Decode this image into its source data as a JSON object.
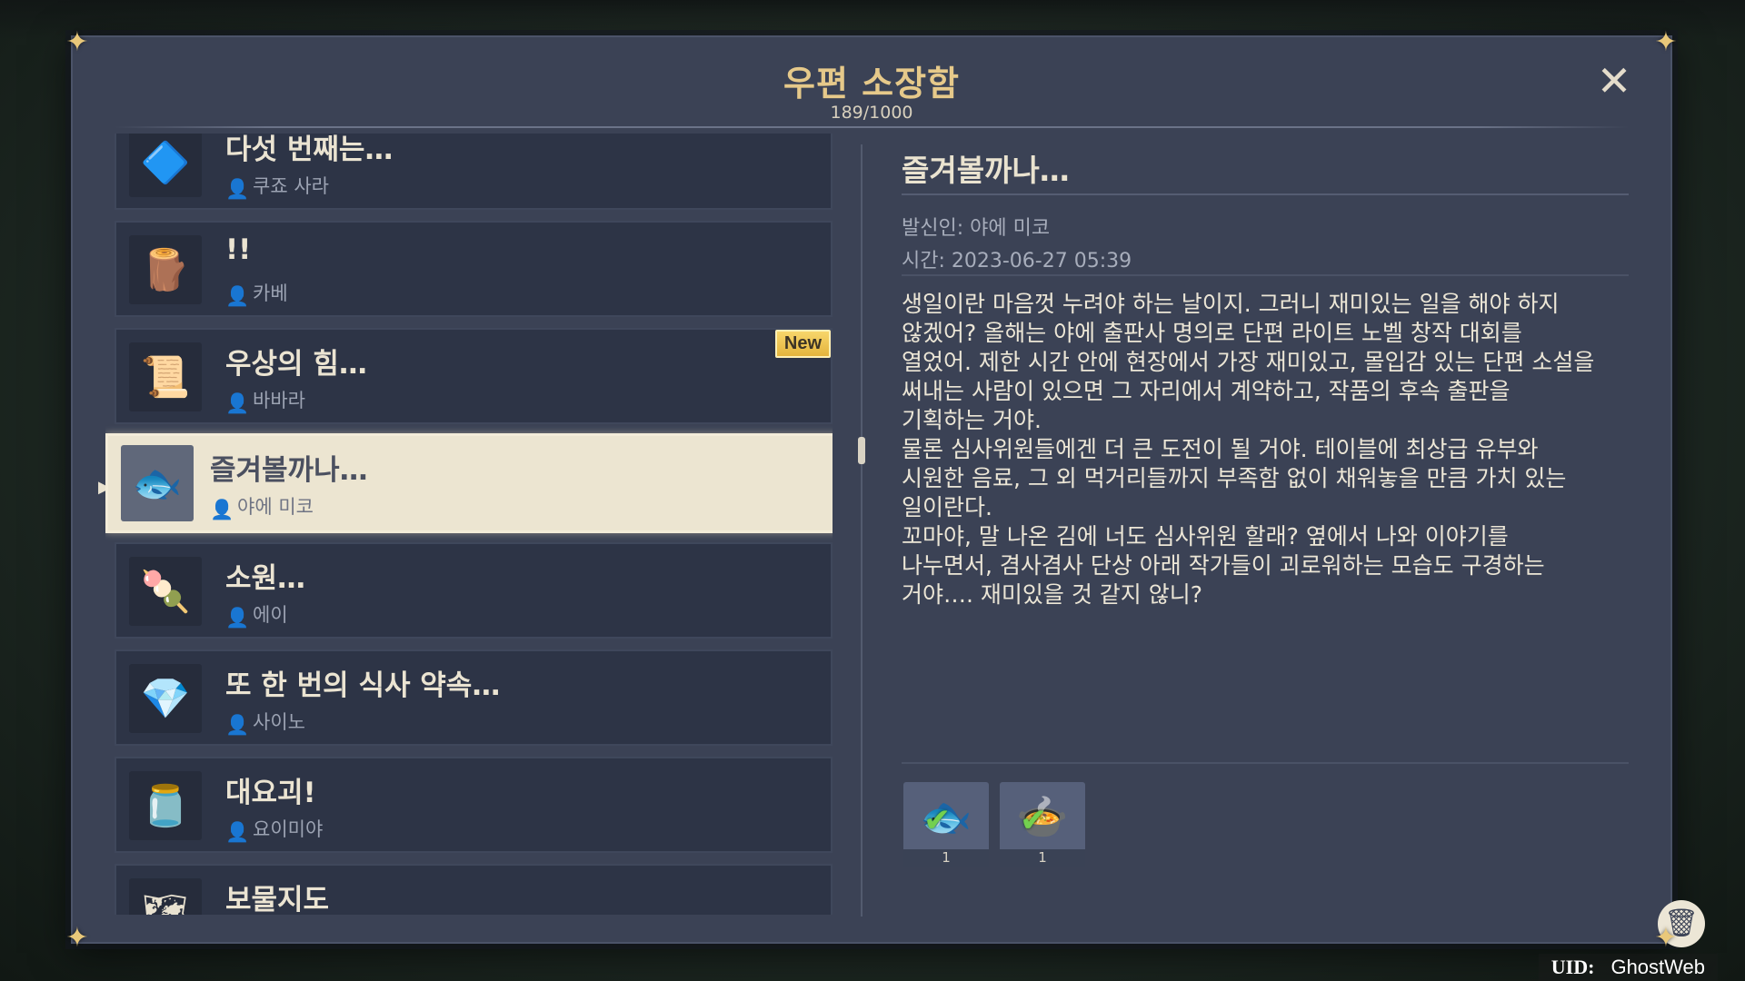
{
  "window": {
    "title": "우편 소장함",
    "count": "189/1000"
  },
  "mail_list": [
    {
      "title": "다섯 번째는…",
      "sender": "쿠죠 사라",
      "thumb": "badge-icon",
      "new": false,
      "selected": false
    },
    {
      "title": "!!",
      "sender": "카베",
      "thumb": "sack-icon",
      "new": false,
      "selected": false
    },
    {
      "title": "우상의 힘…",
      "sender": "바바라",
      "thumb": "cloth-icon",
      "new": true,
      "selected": false
    },
    {
      "title": "즐겨볼까나…",
      "sender": "야에 미코",
      "thumb": "fish-icon",
      "new": false,
      "selected": true
    },
    {
      "title": "소원…",
      "sender": "에이",
      "thumb": "dango-icon",
      "new": false,
      "selected": false
    },
    {
      "title": "또 한 번의 식사 약속…",
      "sender": "사이노",
      "thumb": "crystal-icon",
      "new": false,
      "selected": false
    },
    {
      "title": "대요괴!",
      "sender": "요이미야",
      "thumb": "jar-icon",
      "new": false,
      "selected": false
    },
    {
      "title": "보물지도",
      "sender": "",
      "thumb": "map-icon",
      "new": false,
      "selected": false
    }
  ],
  "new_badge": "New",
  "detail": {
    "title": "즐겨볼까나…",
    "sender": "발신인: 야에 미코",
    "time": "시간: 2023-06-27 05:39",
    "body": "생일이란 마음껏 누려야 하는 날이지. 그러니 재미있는 일을 해야 하지\n않겠어? 올해는 야에 출판사 명의로 단편 라이트 노벨 창작 대회를\n열었어. 제한 시간 안에 현장에서 가장 재미있고, 몰입감 있는 단편 소설을\n써내는 사람이 있으면 그 자리에서 계약하고, 작품의 후속 출판을\n기획하는 거야.\n물론 심사위원들에겐 더 큰 도전이 될 거야. 테이블에 최상급 유부와\n시원한 음료, 그 외 먹거리들까지 부족함 없이 채워놓을 만큼 가치 있는\n일이란다.\n꼬마야, 말 나온 김에 너도 심사위원 할래? 옆에서 나와 이야기를\n나누면서, 겸사겸사 단상 아래 작가들이 괴로워하는 모습도 구경하는\n거야…. 재미있을 것 같지 않니?",
    "attachments": [
      {
        "icon": "fish-icon",
        "qty": "1",
        "claimed": true
      },
      {
        "icon": "soup-bowl-icon",
        "qty": "1",
        "claimed": true
      }
    ]
  },
  "uid": {
    "label": "UID:",
    "value": "GhostWeb"
  }
}
